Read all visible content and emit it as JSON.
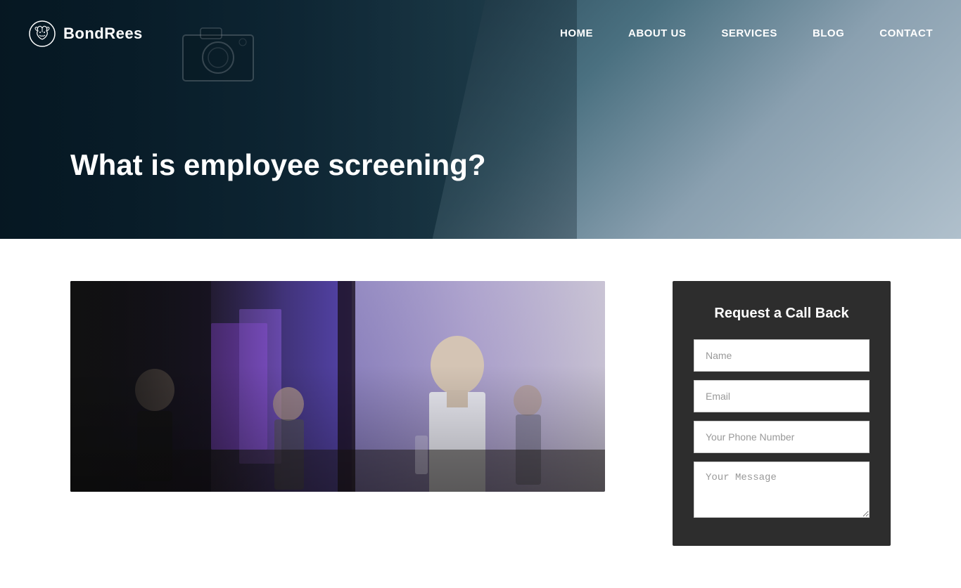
{
  "navbar": {
    "logo_text": "BondRees",
    "links": [
      {
        "id": "home",
        "label": "HOME"
      },
      {
        "id": "about",
        "label": "ABOUT US"
      },
      {
        "id": "services",
        "label": "SERVICES"
      },
      {
        "id": "blog",
        "label": "BLOG"
      },
      {
        "id": "contact",
        "label": "CONTACT"
      }
    ]
  },
  "hero": {
    "title": "What is employee screening?"
  },
  "form": {
    "title": "Request a Call Back",
    "fields": [
      {
        "id": "name",
        "placeholder": "Name",
        "type": "text"
      },
      {
        "id": "email",
        "placeholder": "Email",
        "type": "email"
      },
      {
        "id": "phone",
        "placeholder": "Your Phone Number",
        "type": "tel"
      },
      {
        "id": "message",
        "placeholder": "Your Message",
        "type": "textarea"
      }
    ]
  }
}
